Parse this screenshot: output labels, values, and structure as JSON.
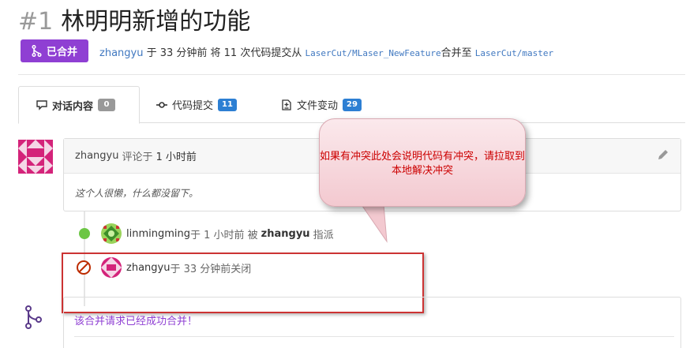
{
  "pr": {
    "number": "#1",
    "title": "林明明新增的功能",
    "status_badge": "已合并",
    "author": "zhangyu",
    "meta_mid": " 于 33 分钟前 将 11 次代码提交从 ",
    "source_branch": "LaserCut/MLaser_NewFeature",
    "merge_word": "合并至 ",
    "target_branch": "LaserCut/master"
  },
  "tabs": [
    {
      "label": "对话内容",
      "count": "0",
      "icon": "comment-icon"
    },
    {
      "label": "代码提交",
      "count": "11",
      "icon": "commit-icon"
    },
    {
      "label": "文件变动",
      "count": "29",
      "icon": "file-diff-icon"
    }
  ],
  "comment": {
    "author": "zhangyu",
    "action": "评论于",
    "time": "1 小时前",
    "body": "这个人很懒，什么都没留下。"
  },
  "events": {
    "assign": {
      "user": "linmingming",
      "mid": " 于 1 小时前 被",
      "by": "zhangyu",
      "action": "指派"
    },
    "close": {
      "user": "zhangyu",
      "mid": " 于 33 分钟前 ",
      "action": "关闭"
    }
  },
  "merge": {
    "message": "该合并请求已经成功合并！"
  },
  "callout": {
    "text": "如果有冲突此处会说明代码有冲突，请拉取到本地解决冲突"
  },
  "colors": {
    "merged": "#8f3fd3",
    "link": "#4078c0",
    "count_blue": "#2d7fd3",
    "green": "#6cc644",
    "closed": "#bd2c00",
    "annotation": "#cc3333"
  }
}
